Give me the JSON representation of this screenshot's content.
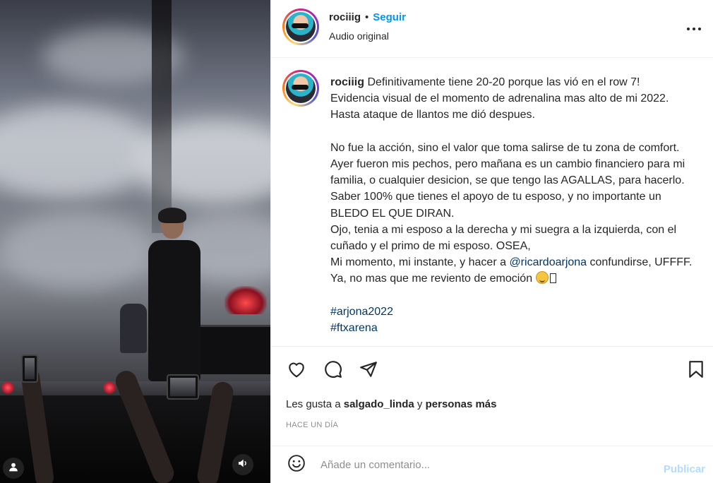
{
  "post": {
    "username": "rociiig",
    "follow_label": "Seguir",
    "audio_label": "Audio original",
    "separator": "•"
  },
  "caption": {
    "username": "rociiig",
    "line1": "Definitivamente tiene 20-20 porque las vió en el row 7!",
    "line2": "Evidencia visual de el momento de adrenalina mas alto de mi 2022.",
    "line3": "Hasta ataque de llantos me dió despues.",
    "para2": "No fue la acción, sino el valor que toma salirse de tu zona de comfort. Ayer fueron mis pechos, pero mañana es un cambio financiero para mi familia, o cualquier desicion, se que tengo las AGALLAS, para hacerlo. Saber 100% que tienes el apoyo de tu esposo, y no importante un BLEDO EL QUE DIRAN.",
    "para3": "Ojo, tenia a mi esposo a la derecha y mi suegra a la izquierda, con el cuñado y el primo de mi esposo. OSEA,",
    "para4_before": "Mi momento, mi instante, y hacer a ",
    "mention": "@ricardoarjona",
    "para4_after": " confundirse, UFFFF. Ya, no mas que me reviento de emoción ",
    "hashtag1": "#arjona2022",
    "hashtag2": "#ftxarena"
  },
  "engagement": {
    "likes_prefix": "Les gusta a ",
    "likes_user": "salgado_linda",
    "likes_mid": " y ",
    "likes_others": "personas más",
    "time_ago": "HACE UN DÍA"
  },
  "comment": {
    "placeholder": "Añade un comentario...",
    "publish_label": "Publicar"
  },
  "icons": {
    "like": "heart-icon",
    "comment": "comment-bubble-icon",
    "share": "paper-plane-icon",
    "save": "bookmark-icon",
    "more": "more-options-icon",
    "emoji": "smiley-icon",
    "user_tags": "user-icon",
    "audio": "speaker-icon"
  },
  "colors": {
    "follow": "#0095f6",
    "link": "#00376b",
    "publish_disabled": "#b3dbff",
    "muted": "#8e8e8e"
  }
}
